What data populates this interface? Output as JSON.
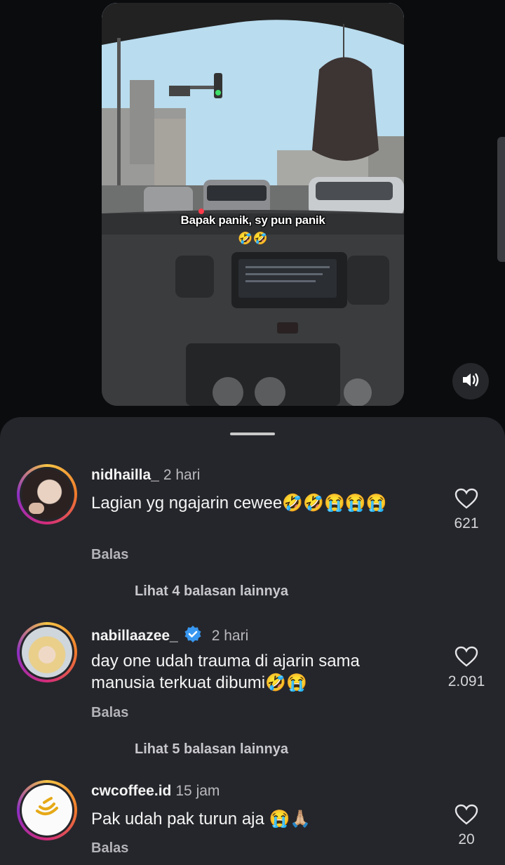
{
  "video": {
    "caption": "Bapak panik, sy pun panik",
    "caption_emoji": "🤣🤣"
  },
  "comments": [
    {
      "username": "nidhailla_",
      "time": "2 hari",
      "text": "Lagian yg ngajarin cewee🤣🤣😭😭😭",
      "reply_label": "Balas",
      "likes": "621",
      "more_replies": "Lihat 4 balasan lainnya",
      "verified": false
    },
    {
      "username": "nabillaazee_",
      "time": "2 hari",
      "text": "day one udah trauma di ajarin sama manusia terkuat dibumi🤣😭",
      "reply_label": "Balas",
      "likes": "2.091",
      "more_replies": "Lihat 5 balasan lainnya",
      "verified": true
    },
    {
      "username": "cwcoffee.id",
      "time": "15 jam",
      "text": "Pak udah pak turun aja 😭🙏🏼",
      "reply_label": "Balas",
      "likes": "20",
      "verified": false
    }
  ],
  "icons": {
    "mute": "speaker-icon",
    "like": "heart-icon",
    "verified": "verified-badge-icon"
  },
  "colors": {
    "sheet_bg": "#25262b",
    "verified_blue": "#3897f0",
    "page_bg": "#0b0c0e"
  }
}
